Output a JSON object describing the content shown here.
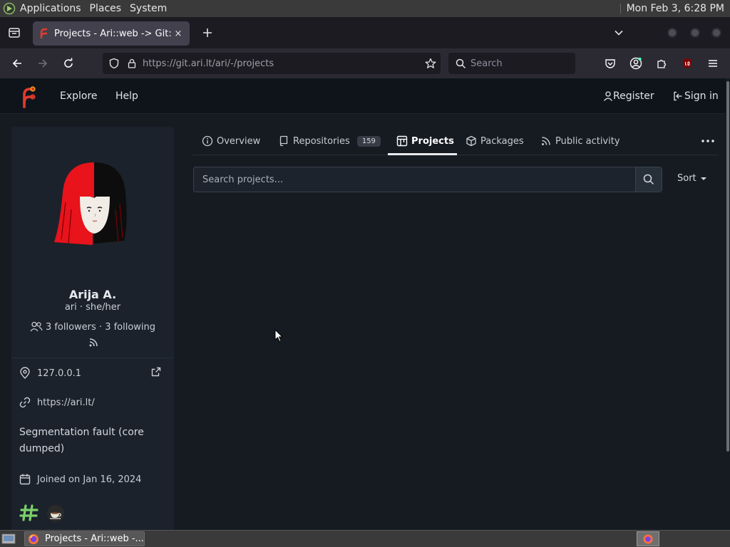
{
  "desktop": {
    "panel": {
      "menus": [
        "Applications",
        "Places",
        "System"
      ],
      "clock": "Mon Feb  3,  6:28 PM"
    },
    "taskbar": {
      "window_title": "Projects - Ari::web -..."
    }
  },
  "browser": {
    "tab": {
      "title": "Projects - Ari::web -> Git: Th",
      "close_icon": "×"
    },
    "url": "https://git.ari.lt/ari/-/projects",
    "search_placeholder": "Search"
  },
  "site": {
    "nav": {
      "explore": "Explore",
      "help": "Help",
      "register": "Register",
      "sign_in": "Sign in"
    }
  },
  "profile": {
    "name": "Arija A.",
    "handle": "ari · she/her",
    "followers": "3 followers · 3 following",
    "location": "127.0.0.1",
    "website": "https://ari.lt/",
    "bio": "Segmentation fault (core dumped)",
    "joined": "Joined on Jan 16, 2024"
  },
  "tabs": {
    "overview": "Overview",
    "repositories": "Repositories",
    "repositories_count": "159",
    "projects": "Projects",
    "packages": "Packages",
    "public_activity": "Public activity"
  },
  "projects": {
    "search_placeholder": "Search projects...",
    "sort_label": "Sort"
  },
  "colors": {
    "page_bg": "#161b22",
    "header_bg": "#0f141b",
    "card_bg": "#1b222b",
    "accent": "#e23b2e"
  },
  "icons": {
    "overview": "info-icon",
    "repositories": "repo-icon",
    "projects": "project-board-icon",
    "packages": "package-icon",
    "public_activity": "rss-icon"
  }
}
